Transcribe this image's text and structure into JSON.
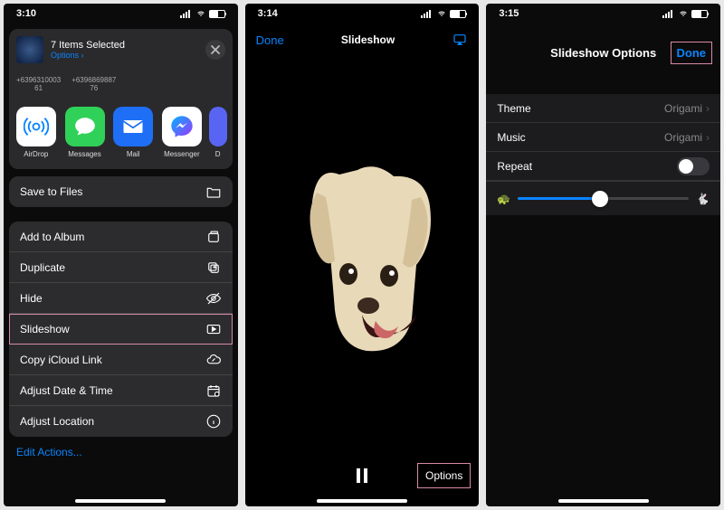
{
  "phone1": {
    "time": "3:10",
    "header": {
      "title": "7 Items Selected",
      "options_label": "Options ›"
    },
    "contacts": [
      {
        "number": "+6396310003",
        "sub": "61"
      },
      {
        "number": "+6396869887",
        "sub": "76"
      }
    ],
    "apps": [
      {
        "label": "AirDrop"
      },
      {
        "label": "Messages"
      },
      {
        "label": "Mail"
      },
      {
        "label": "Messenger"
      },
      {
        "label": "D"
      }
    ],
    "save_to_files": "Save to Files",
    "actions": [
      {
        "label": "Add to Album"
      },
      {
        "label": "Duplicate"
      },
      {
        "label": "Hide"
      },
      {
        "label": "Slideshow"
      },
      {
        "label": "Copy iCloud Link"
      },
      {
        "label": "Adjust Date & Time"
      },
      {
        "label": "Adjust Location"
      }
    ],
    "edit_actions": "Edit Actions..."
  },
  "phone2": {
    "time": "3:14",
    "done": "Done",
    "title": "Slideshow",
    "options": "Options"
  },
  "phone3": {
    "time": "3:15",
    "title": "Slideshow Options",
    "done": "Done",
    "rows": {
      "theme_label": "Theme",
      "theme_value": "Origami",
      "music_label": "Music",
      "music_value": "Origami",
      "repeat_label": "Repeat"
    },
    "repeat_on": false,
    "speed_value": 0.48
  }
}
